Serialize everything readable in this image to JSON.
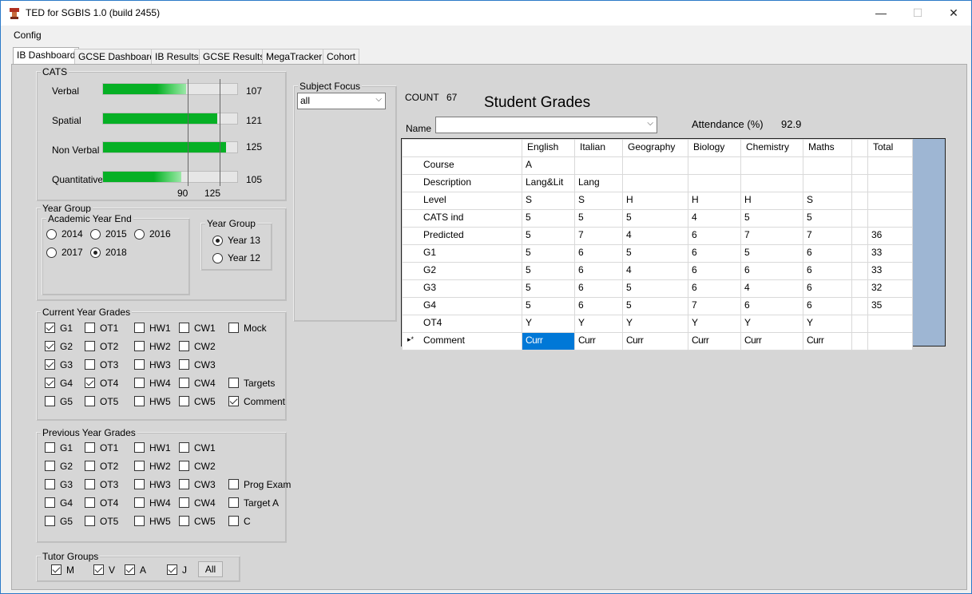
{
  "window": {
    "title": "TED for SGBIS 1.0 (build 2455)",
    "minimize": "—",
    "maximize": "☐",
    "close": "✕"
  },
  "menu": {
    "config": "Config"
  },
  "tabs": [
    "IB Dashboard",
    "GCSE Dashboard",
    "IB Results",
    "GCSE Results",
    "MegaTracker",
    "Cohort"
  ],
  "cats": {
    "title": "CATS",
    "rows": [
      {
        "label": "Verbal",
        "value": "107",
        "level": 107
      },
      {
        "label": "Spatial",
        "value": "121",
        "level": 121
      },
      {
        "label": "Non Verbal",
        "value": "125",
        "level": 125
      },
      {
        "label": "Quantitative",
        "value": "105",
        "level": 105
      }
    ],
    "marker_low": "90",
    "marker_high": "125"
  },
  "year_group_box": {
    "title": "Year Group",
    "academic_title": "Academic Year End",
    "years": [
      {
        "label": "2014",
        "checked": false
      },
      {
        "label": "2015",
        "checked": false
      },
      {
        "label": "2016",
        "checked": false
      },
      {
        "label": "2017",
        "checked": false
      },
      {
        "label": "2018",
        "checked": true
      }
    ],
    "group_title": "Year Group",
    "groups": [
      {
        "label": "Year 13",
        "checked": true
      },
      {
        "label": "Year 12",
        "checked": false
      }
    ]
  },
  "current_grades": {
    "title": "Current Year Grades",
    "items": [
      {
        "label": "G1",
        "checked": true
      },
      {
        "label": "OT1",
        "checked": false
      },
      {
        "label": "HW1",
        "checked": false
      },
      {
        "label": "CW1",
        "checked": false
      },
      {
        "label": "Mock",
        "checked": false
      },
      {
        "label": "G2",
        "checked": true
      },
      {
        "label": "OT2",
        "checked": false
      },
      {
        "label": "HW2",
        "checked": false
      },
      {
        "label": "CW2",
        "checked": false
      },
      {
        "label": "",
        "checked": false
      },
      {
        "label": "G3",
        "checked": true
      },
      {
        "label": "OT3",
        "checked": false
      },
      {
        "label": "HW3",
        "checked": false
      },
      {
        "label": "CW3",
        "checked": false
      },
      {
        "label": "",
        "checked": false
      },
      {
        "label": "G4",
        "checked": true
      },
      {
        "label": "OT4",
        "checked": true
      },
      {
        "label": "HW4",
        "checked": false
      },
      {
        "label": "CW4",
        "checked": false
      },
      {
        "label": "Targets",
        "checked": false
      },
      {
        "label": "G5",
        "checked": false
      },
      {
        "label": "OT5",
        "checked": false
      },
      {
        "label": "HW5",
        "checked": false
      },
      {
        "label": "CW5",
        "checked": false
      },
      {
        "label": "Comment",
        "checked": true
      }
    ]
  },
  "previous_grades": {
    "title": "Previous Year Grades",
    "items": [
      {
        "label": "G1",
        "checked": false
      },
      {
        "label": "OT1",
        "checked": false
      },
      {
        "label": "HW1",
        "checked": false
      },
      {
        "label": "CW1",
        "checked": false
      },
      {
        "label": "",
        "checked": false
      },
      {
        "label": "G2",
        "checked": false
      },
      {
        "label": "OT2",
        "checked": false
      },
      {
        "label": "HW2",
        "checked": false
      },
      {
        "label": "CW2",
        "checked": false
      },
      {
        "label": "",
        "checked": false
      },
      {
        "label": "G3",
        "checked": false
      },
      {
        "label": "OT3",
        "checked": false
      },
      {
        "label": "HW3",
        "checked": false
      },
      {
        "label": "CW3",
        "checked": false
      },
      {
        "label": "Prog Exam",
        "checked": false
      },
      {
        "label": "G4",
        "checked": false
      },
      {
        "label": "OT4",
        "checked": false
      },
      {
        "label": "HW4",
        "checked": false
      },
      {
        "label": "CW4",
        "checked": false
      },
      {
        "label": "Target A",
        "checked": false
      },
      {
        "label": "G5",
        "checked": false
      },
      {
        "label": "OT5",
        "checked": false
      },
      {
        "label": "HW5",
        "checked": false
      },
      {
        "label": "CW5",
        "checked": false
      },
      {
        "label": "C",
        "checked": false
      }
    ]
  },
  "tutor_groups": {
    "title": "Tutor Groups",
    "items": [
      {
        "label": "M",
        "checked": true
      },
      {
        "label": "V",
        "checked": true
      },
      {
        "label": "A",
        "checked": true
      },
      {
        "label": "J",
        "checked": true
      }
    ],
    "all_button": "All"
  },
  "subject_focus": {
    "title": "Subject Focus",
    "value": "all"
  },
  "count": {
    "label": "COUNT",
    "value": "67"
  },
  "heading": "Student Grades",
  "name": {
    "label": "Name",
    "value": ""
  },
  "attendance": {
    "label": "Attendance (%)",
    "value": "92.9"
  },
  "grid": {
    "columns": [
      "English",
      "Italian",
      "Geography",
      "Biology",
      "Chemistry",
      "Maths",
      "",
      "Total"
    ],
    "rows": [
      {
        "header": "Course",
        "cells": [
          "A",
          "",
          "",
          "",
          "",
          "",
          "",
          ""
        ]
      },
      {
        "header": "Description",
        "cells": [
          "Lang&Lit",
          "Lang",
          "",
          "",
          "",
          "",
          "",
          ""
        ]
      },
      {
        "header": "Level",
        "cells": [
          "S",
          "S",
          "H",
          "H",
          "H",
          "S",
          "",
          ""
        ]
      },
      {
        "header": "CATS ind",
        "cells": [
          "5",
          "5",
          "5",
          "4",
          "5",
          "5",
          "",
          ""
        ]
      },
      {
        "header": "Predicted",
        "cells": [
          "5",
          "7",
          "4",
          "6",
          "7",
          "7",
          "",
          "36"
        ]
      },
      {
        "header": "G1",
        "cells": [
          "5",
          "6",
          "5",
          "6",
          "5",
          "6",
          "",
          "33"
        ]
      },
      {
        "header": "G2",
        "cells": [
          "5",
          "6",
          "4",
          "6",
          "6",
          "6",
          "",
          "33"
        ]
      },
      {
        "header": "G3",
        "cells": [
          "5",
          "6",
          "5",
          "6",
          "4",
          "6",
          "",
          "32"
        ]
      },
      {
        "header": "G4",
        "cells": [
          "5",
          "6",
          "5",
          "7",
          "6",
          "6",
          "",
          "35"
        ]
      },
      {
        "header": "OT4",
        "cells": [
          "Y",
          "Y",
          "Y",
          "Y",
          "Y",
          "Y",
          "",
          ""
        ]
      },
      {
        "header": "Comment",
        "cells": [
          "Curr",
          "Curr",
          "Curr",
          "Curr",
          "Curr",
          "Curr",
          "",
          ""
        ]
      }
    ],
    "row_indicator": "▸*"
  },
  "colors": {
    "accent": "#0078d7",
    "bar_green": "#06b025",
    "panel_bg": "#d6d6d6",
    "grid_side": "#9eb6d3"
  }
}
